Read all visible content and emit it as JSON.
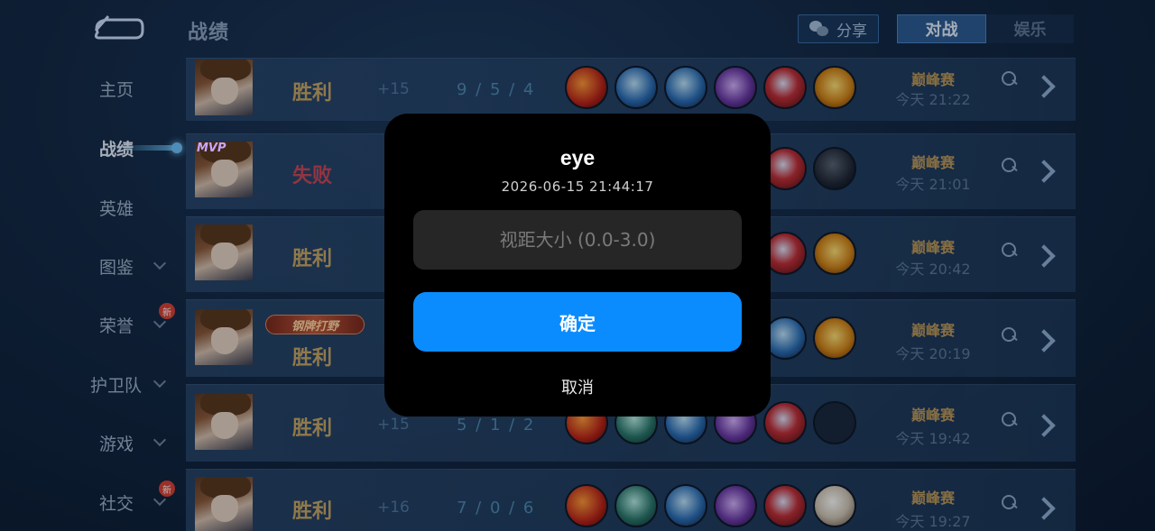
{
  "header": {
    "title": "战绩",
    "share_label": "分享",
    "tabs": [
      {
        "label": "对战",
        "active": true
      },
      {
        "label": "娱乐",
        "active": false
      }
    ]
  },
  "sidebar": {
    "items": [
      {
        "label": "主页"
      },
      {
        "label": "战绩",
        "active": true
      },
      {
        "label": "英雄"
      },
      {
        "label": "图鉴"
      },
      {
        "label": "荣誉",
        "badge": "新"
      },
      {
        "label": "护卫队"
      },
      {
        "label": "游戏"
      },
      {
        "label": "社交",
        "badge": "新"
      }
    ]
  },
  "matches": [
    {
      "result": "胜利",
      "score": "+15",
      "kda": "9 / 5 / 4",
      "mode": "巅峰赛",
      "time": "今天 21:22"
    },
    {
      "mvp": "MVP",
      "result": "失败",
      "mode": "巅峰赛",
      "time": "今天 21:01"
    },
    {
      "result": "胜利",
      "mode": "巅峰赛",
      "time": "今天 20:42"
    },
    {
      "tag": "钢牌打野",
      "result": "胜利",
      "mode": "巅峰赛",
      "time": "今天 20:19"
    },
    {
      "result": "胜利",
      "score": "+15",
      "kda": "5 / 1 / 2",
      "mode": "巅峰赛",
      "time": "今天 19:42"
    },
    {
      "result": "胜利",
      "score": "+16",
      "kda": "7 / 0 / 6",
      "mode": "巅峰赛",
      "time": "今天 19:27"
    }
  ],
  "dialog": {
    "title": "eye",
    "timestamp": "2026-06-15 21:44:17",
    "input_placeholder": "视距大小 (0.0-3.0)",
    "input_value": "",
    "confirm_label": "确定",
    "cancel_label": "取消"
  },
  "colors": {
    "accent": "#0a8cff",
    "win": "#c8a868",
    "lose": "#c84a5a"
  }
}
